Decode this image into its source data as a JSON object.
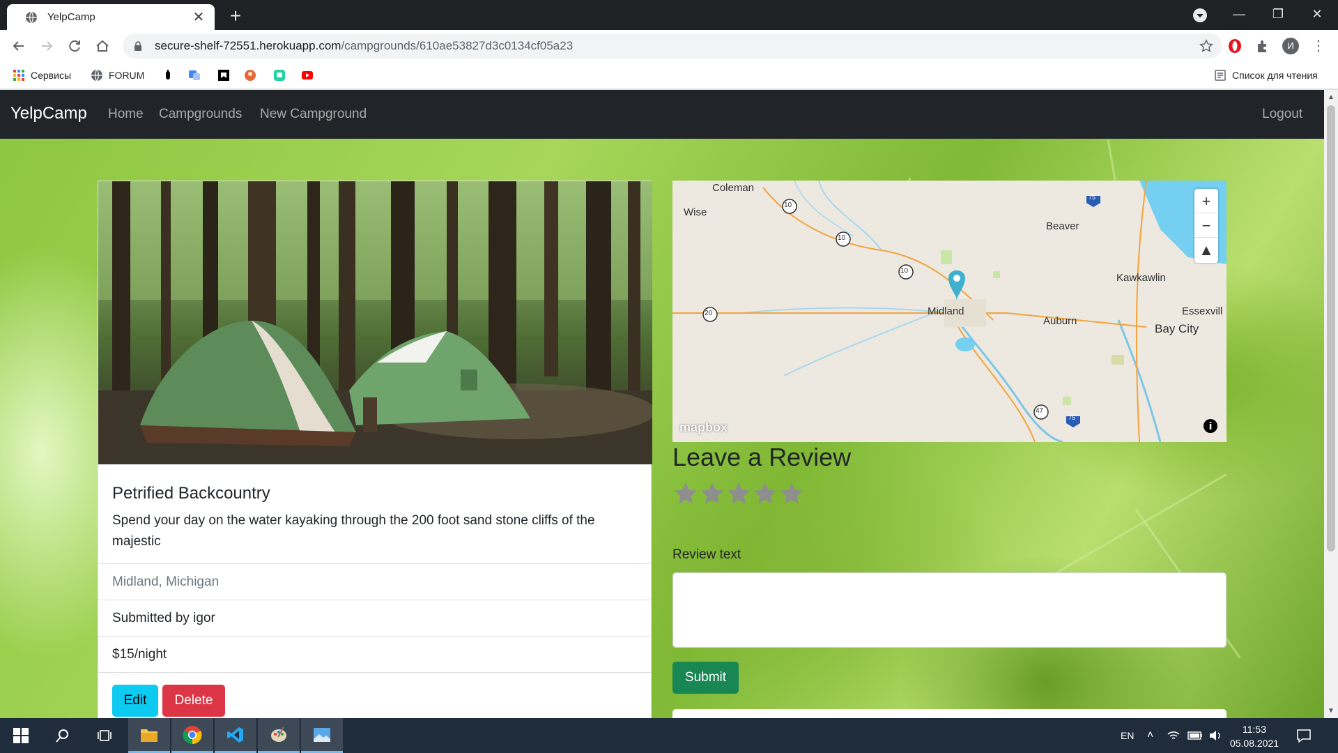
{
  "browser": {
    "tab_title": "YelpCamp",
    "url_host": "secure-shelf-72551.herokuapp.com",
    "url_path": "/campgrounds/610ae53827d3c0134cf05a23",
    "bookmarks": [
      "Сервисы",
      "FORUM"
    ],
    "reading_list": "Список для чтения",
    "profile_initial": "И"
  },
  "navbar": {
    "brand": "YelpCamp",
    "links": [
      "Home",
      "Campgrounds",
      "New Campground"
    ],
    "logout": "Logout"
  },
  "campground": {
    "title": "Petrified Backcountry",
    "description": "Spend your day on the water kayaking through the 200 foot sand stone cliffs of the majestic",
    "location": "Midland, Michigan",
    "submitted_by": "Submitted by igor",
    "price": "$15/night",
    "edit_label": "Edit",
    "delete_label": "Delete"
  },
  "map": {
    "labels": [
      "Coleman",
      "Wise",
      "Beaver",
      "Kawkawlin",
      "Essexvill",
      "Midland",
      "Auburn",
      "Bay City"
    ],
    "route_shields": [
      "10",
      "10",
      "10",
      "20",
      "47",
      "75",
      "75"
    ],
    "attribution": "mapbox",
    "zoom_in": "+",
    "zoom_out": "−"
  },
  "review": {
    "heading": "Leave a Review",
    "star_count": 5,
    "text_label": "Review text",
    "submit_label": "Submit"
  },
  "taskbar": {
    "lang": "EN",
    "time": "11:53",
    "date": "05.08.2021"
  },
  "colors": {
    "navbar": "#212529",
    "btn_info": "#0dcaf0",
    "btn_danger": "#dc3545",
    "btn_success": "#198754",
    "map_pin": "#3fb1ce"
  }
}
